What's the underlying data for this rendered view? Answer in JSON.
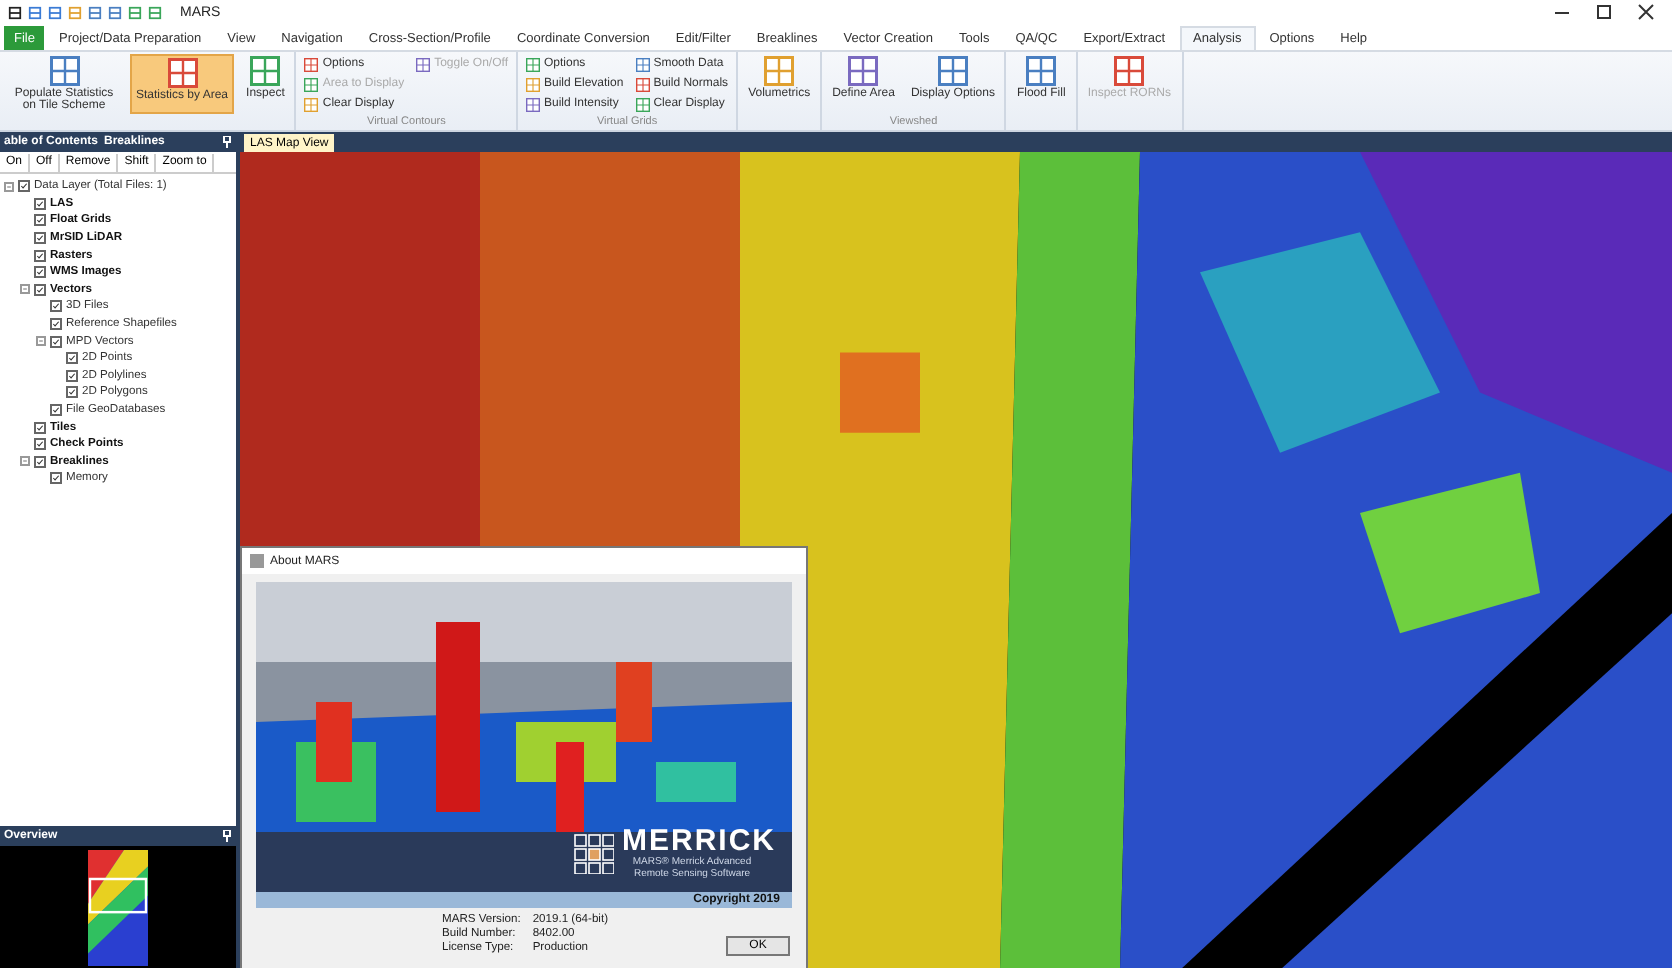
{
  "window": {
    "title": "MARS"
  },
  "menu_tabs": [
    {
      "label": "File",
      "kind": "file",
      "selected": false
    },
    {
      "label": "Project/Data Preparation",
      "kind": "tab",
      "selected": false
    },
    {
      "label": "View",
      "kind": "tab",
      "selected": false
    },
    {
      "label": "Navigation",
      "kind": "tab",
      "selected": false
    },
    {
      "label": "Cross-Section/Profile",
      "kind": "tab",
      "selected": false
    },
    {
      "label": "Coordinate Conversion",
      "kind": "tab",
      "selected": false
    },
    {
      "label": "Edit/Filter",
      "kind": "tab",
      "selected": false
    },
    {
      "label": "Breaklines",
      "kind": "tab",
      "selected": false
    },
    {
      "label": "Vector Creation",
      "kind": "tab",
      "selected": false
    },
    {
      "label": "Tools",
      "kind": "tab",
      "selected": false
    },
    {
      "label": "QA/QC",
      "kind": "tab",
      "selected": false
    },
    {
      "label": "Export/Extract",
      "kind": "tab",
      "selected": false
    },
    {
      "label": "Analysis",
      "kind": "tab",
      "selected": true
    },
    {
      "label": "Options",
      "kind": "tab",
      "selected": false
    },
    {
      "label": "Help",
      "kind": "tab",
      "selected": false
    }
  ],
  "ribbon_groups": [
    {
      "items": [
        {
          "kind": "large",
          "label": "Populate Statistics on Tile Scheme",
          "selected": false,
          "disabled": false
        },
        {
          "kind": "large",
          "label": "Statistics by Area",
          "selected": true,
          "disabled": false
        },
        {
          "kind": "large",
          "label": "Inspect",
          "selected": false,
          "disabled": false
        }
      ]
    },
    {
      "label": "Virtual Contours",
      "items": [
        {
          "kind": "small",
          "label": "Options",
          "disabled": false
        },
        {
          "kind": "small",
          "label": "Area to Display",
          "disabled": true
        },
        {
          "kind": "small",
          "label": "Clear Display",
          "disabled": false
        },
        {
          "kind": "small",
          "label": "Toggle On/Off",
          "disabled": true
        }
      ]
    },
    {
      "label": "Virtual Grids",
      "items": [
        {
          "kind": "small",
          "label": "Options",
          "disabled": false
        },
        {
          "kind": "small",
          "label": "Build Elevation",
          "disabled": false
        },
        {
          "kind": "small",
          "label": "Build Intensity",
          "disabled": false
        },
        {
          "kind": "small",
          "label": "Smooth Data",
          "disabled": false
        },
        {
          "kind": "small",
          "label": "Build Normals",
          "disabled": false
        },
        {
          "kind": "small",
          "label": "Clear Display",
          "disabled": false
        }
      ]
    },
    {
      "items": [
        {
          "kind": "large",
          "label": "Volumetrics",
          "selected": false,
          "disabled": false
        }
      ]
    },
    {
      "label": "Viewshed",
      "items": [
        {
          "kind": "large",
          "label": "Define Area",
          "selected": false,
          "disabled": false
        },
        {
          "kind": "large",
          "label": "Display Options",
          "selected": false,
          "disabled": false
        }
      ]
    },
    {
      "items": [
        {
          "kind": "large",
          "label": "Flood Fill",
          "selected": false,
          "disabled": false
        }
      ]
    },
    {
      "items": [
        {
          "kind": "large",
          "label": "Inspect RORNs",
          "selected": false,
          "disabled": true
        }
      ]
    }
  ],
  "toc": {
    "title": "able of Contents",
    "subtitle": "Breaklines",
    "toolbar": [
      "On",
      "Off",
      "Remove",
      "Shift",
      "Zoom to"
    ],
    "tree": [
      {
        "label": "Data Layer (Total Files: 1)",
        "checked": true,
        "expanded": true,
        "children": [
          {
            "label": "LAS",
            "checked": true
          },
          {
            "label": "Float Grids",
            "checked": true
          },
          {
            "label": "MrSID LiDAR",
            "checked": true
          },
          {
            "label": "Rasters",
            "checked": true
          },
          {
            "label": "WMS Images",
            "checked": true
          },
          {
            "label": "Vectors",
            "checked": true,
            "expanded": true,
            "children": [
              {
                "label": "3D Files",
                "checked": true
              },
              {
                "label": "Reference Shapefiles",
                "checked": true
              },
              {
                "label": "MPD Vectors",
                "checked": true,
                "expanded": true,
                "children": [
                  {
                    "label": "2D Points",
                    "checked": true
                  },
                  {
                    "label": "2D Polylines",
                    "checked": true
                  },
                  {
                    "label": "2D Polygons",
                    "checked": true
                  }
                ]
              },
              {
                "label": "File GeoDatabases",
                "checked": true
              }
            ]
          },
          {
            "label": "Tiles",
            "checked": true
          },
          {
            "label": "Check Points",
            "checked": true
          },
          {
            "label": "Breaklines",
            "checked": true,
            "expanded": true,
            "children": [
              {
                "label": "Memory",
                "checked": true
              }
            ]
          }
        ]
      }
    ]
  },
  "overview": {
    "title": "Overview"
  },
  "map": {
    "tab": "LAS Map View"
  },
  "about": {
    "title": "About MARS",
    "brand": "MERRICK",
    "tagline": "MARS® Merrick Advanced Remote Sensing Software",
    "copyright": "Copyright 2019",
    "info": [
      {
        "label": "MARS Version:",
        "value": "2019.1 (64-bit)"
      },
      {
        "label": "Build Number:",
        "value": "8402.00"
      },
      {
        "label": "License Type:",
        "value": "Production"
      }
    ],
    "ok": "OK"
  }
}
